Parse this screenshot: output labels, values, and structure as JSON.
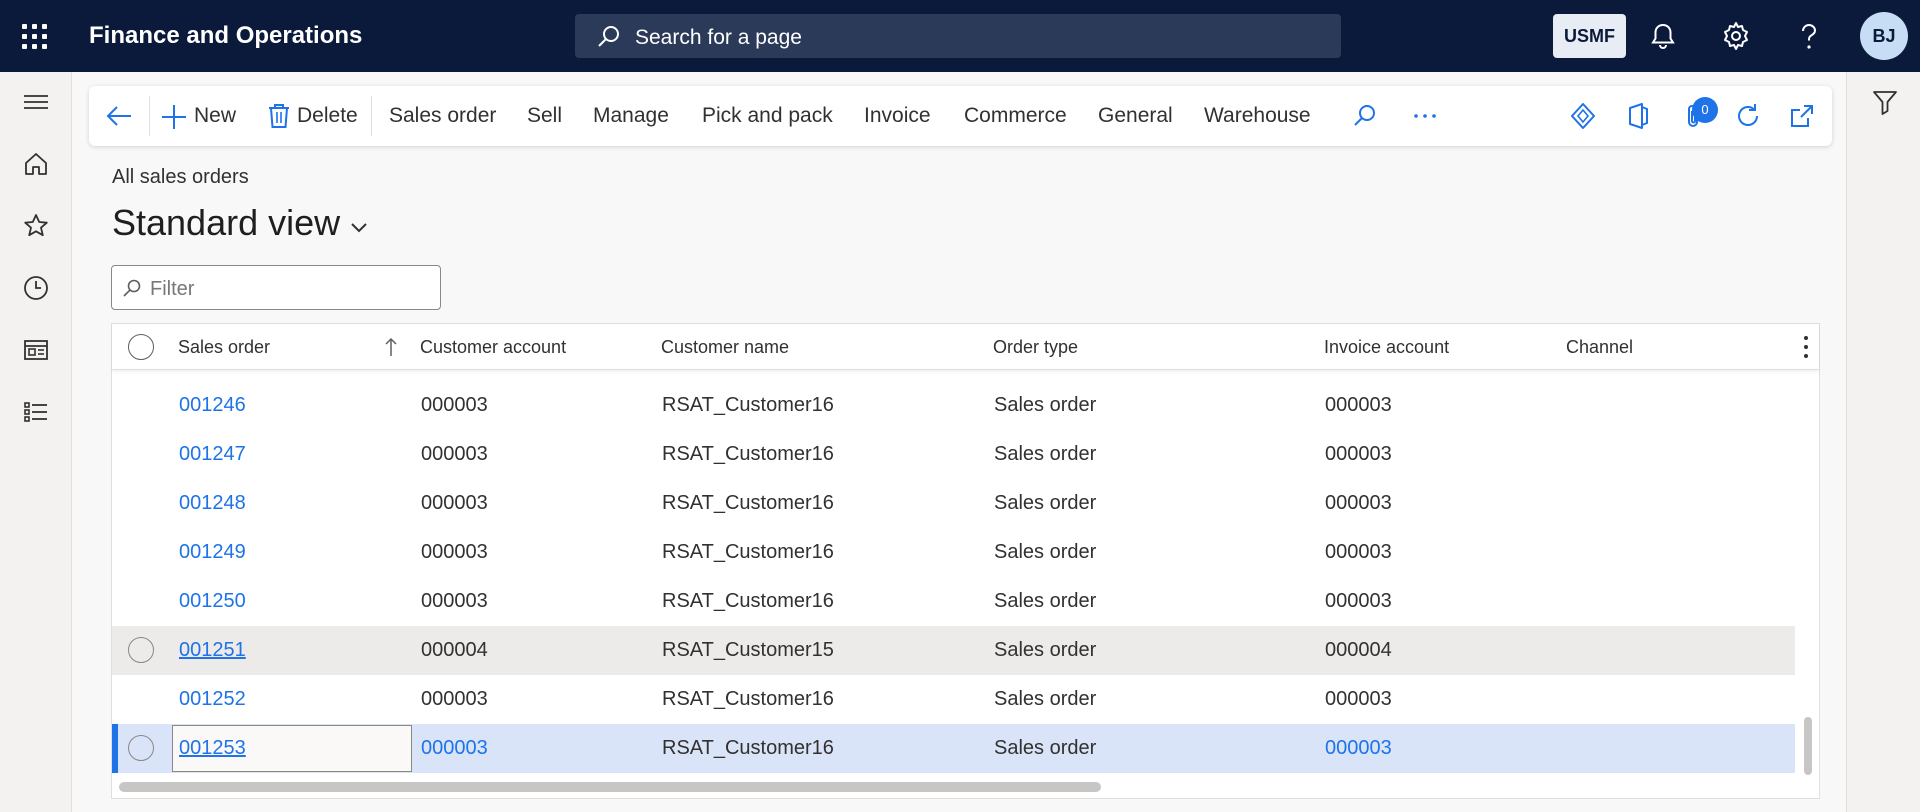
{
  "app": {
    "title": "Finance and Operations",
    "search_placeholder": "Search for a page",
    "company": "USMF",
    "user_initials": "BJ",
    "attachments_count": "0"
  },
  "action_pane": {
    "new_label": "New",
    "delete_label": "Delete",
    "tabs": [
      "Sales order",
      "Sell",
      "Manage",
      "Pick and pack",
      "Invoice",
      "Commerce",
      "General",
      "Warehouse"
    ]
  },
  "page": {
    "breadcrumb": "All sales orders",
    "view_name": "Standard view",
    "filter_placeholder": "Filter"
  },
  "grid": {
    "columns": [
      "Sales order",
      "Customer account",
      "Customer name",
      "Order type",
      "Invoice account",
      "Channel"
    ],
    "rows": [
      {
        "sales_order": "001246",
        "customer_account": "000003",
        "customer_name": "RSAT_Customer16",
        "order_type": "Sales order",
        "invoice_account": "000003",
        "channel": ""
      },
      {
        "sales_order": "001247",
        "customer_account": "000003",
        "customer_name": "RSAT_Customer16",
        "order_type": "Sales order",
        "invoice_account": "000003",
        "channel": ""
      },
      {
        "sales_order": "001248",
        "customer_account": "000003",
        "customer_name": "RSAT_Customer16",
        "order_type": "Sales order",
        "invoice_account": "000003",
        "channel": ""
      },
      {
        "sales_order": "001249",
        "customer_account": "000003",
        "customer_name": "RSAT_Customer16",
        "order_type": "Sales order",
        "invoice_account": "000003",
        "channel": ""
      },
      {
        "sales_order": "001250",
        "customer_account": "000003",
        "customer_name": "RSAT_Customer16",
        "order_type": "Sales order",
        "invoice_account": "000003",
        "channel": ""
      },
      {
        "sales_order": "001251",
        "customer_account": "000004",
        "customer_name": "RSAT_Customer15",
        "order_type": "Sales order",
        "invoice_account": "000004",
        "channel": ""
      },
      {
        "sales_order": "001252",
        "customer_account": "000003",
        "customer_name": "RSAT_Customer16",
        "order_type": "Sales order",
        "invoice_account": "000003",
        "channel": ""
      },
      {
        "sales_order": "001253",
        "customer_account": "000003",
        "customer_name": "RSAT_Customer16",
        "order_type": "Sales order",
        "invoice_account": "000003",
        "channel": ""
      }
    ]
  },
  "colors": {
    "topbar": "#0b1a3b",
    "accent": "#1e73e8",
    "selected_row": "#d9e4f8",
    "hover_row": "#edebe9"
  }
}
